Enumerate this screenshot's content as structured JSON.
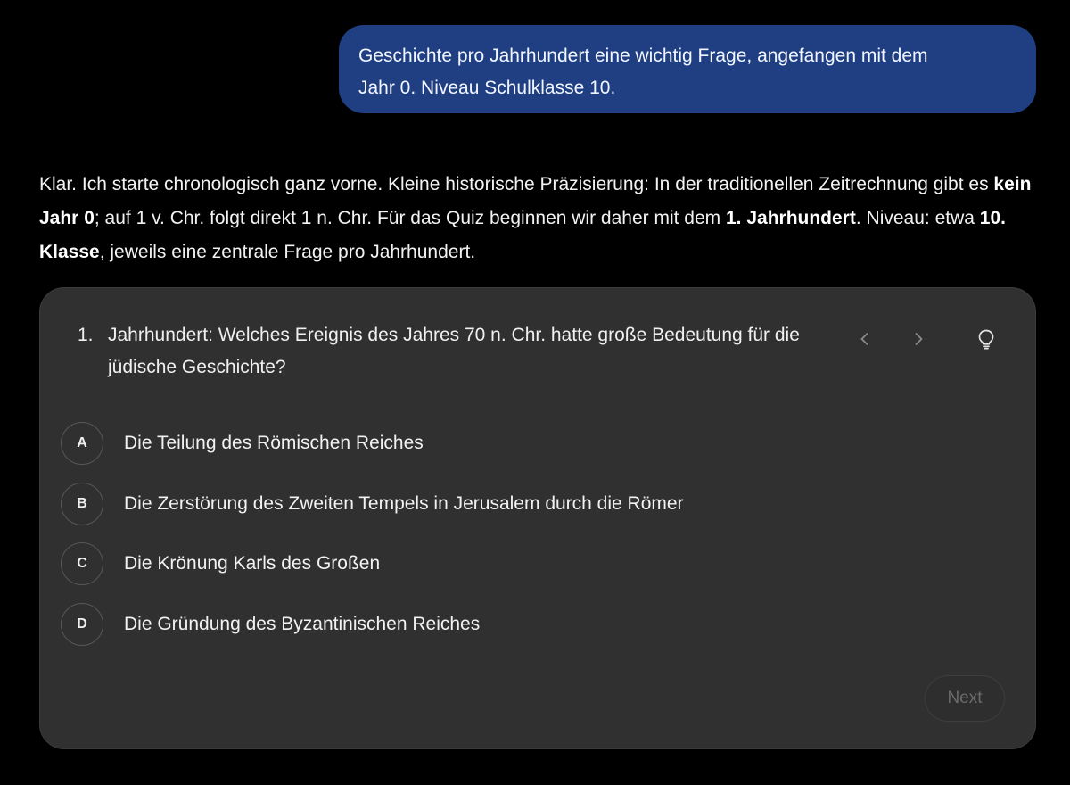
{
  "user_message": {
    "line1": "Geschichte pro Jahrhundert eine wichtig Frage, angefangen mit dem",
    "line2": "Jahr 0. Niveau Schulklasse 10."
  },
  "assistant_message": {
    "p1": "Klar. Ich starte chronologisch ganz vorne. Kleine historische Präzisierung: In der traditionellen Zeitrechnung gibt es ",
    "b1": "kein Jahr 0",
    "p2": "; auf 1 v. Chr. folgt direkt 1 n. Chr. Für das Quiz beginnen wir daher mit dem ",
    "b2": "1. Jahrhundert",
    "p3": ". Niveau: etwa ",
    "b3": "10. Klasse",
    "p4": ", jeweils eine zentrale Frage pro Jahrhundert."
  },
  "quiz": {
    "question_number": "1.",
    "question_text": "Jahrhundert: Welches Ereignis des Jahres 70 n. Chr. hatte große Bedeutung für die jüdische Geschichte?",
    "options": [
      {
        "letter": "A",
        "text": "Die Teilung des Römischen Reiches"
      },
      {
        "letter": "B",
        "text": "Die Zerstörung des Zweiten Tempels in Jerusalem durch die Römer"
      },
      {
        "letter": "C",
        "text": "Die Krönung Karls des Großen"
      },
      {
        "letter": "D",
        "text": "Die Gründung des Byzantinischen Reiches"
      }
    ],
    "next_label": "Next",
    "icons": {
      "prev": "chevron-left-icon",
      "next": "chevron-right-icon",
      "hint": "lightbulb-icon"
    }
  },
  "colors": {
    "background": "#000000",
    "user_bubble": "#1f3f82",
    "card": "#303030",
    "text": "#f2f2f2",
    "muted": "#6b6b6b"
  }
}
